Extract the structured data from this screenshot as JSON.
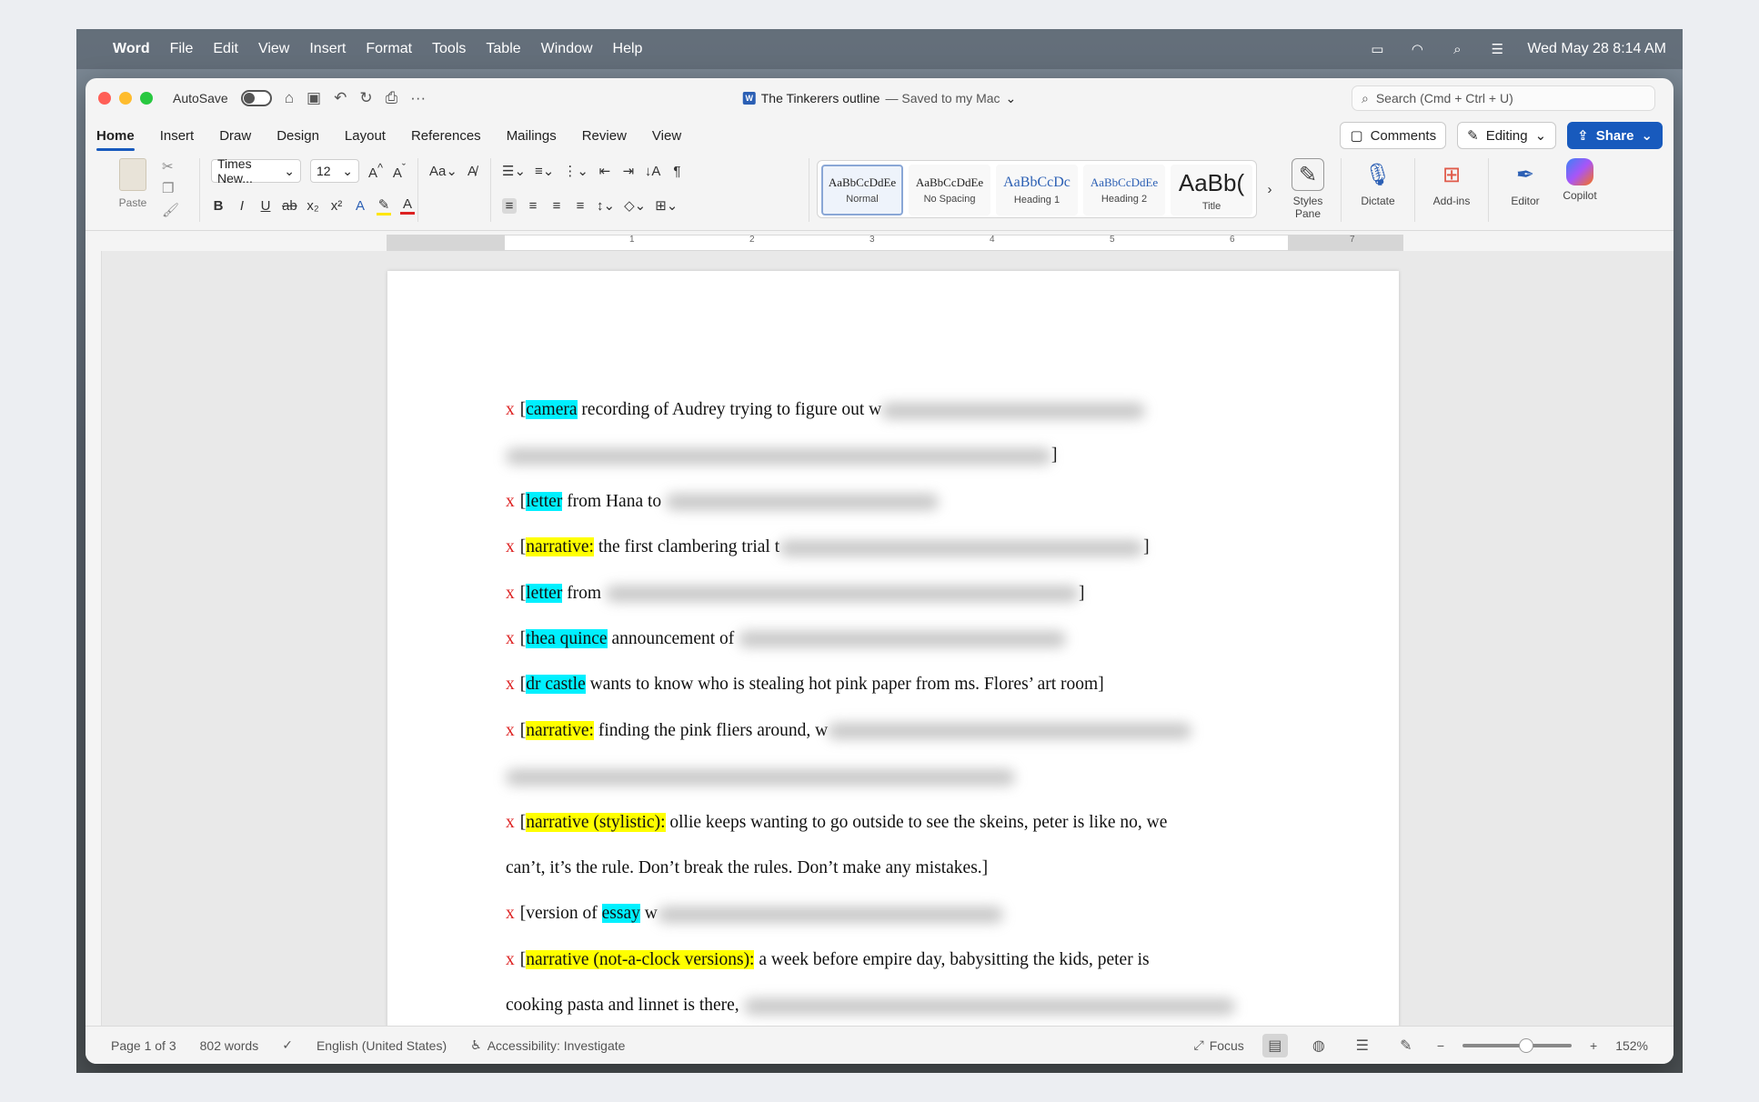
{
  "menubar": {
    "app": "Word",
    "items": [
      "File",
      "Edit",
      "View",
      "Insert",
      "Format",
      "Tools",
      "Table",
      "Window",
      "Help"
    ],
    "datetime": "Wed May 28  8:14 AM"
  },
  "titlebar": {
    "autosave_label": "AutoSave",
    "doc_name": "The Tinkerers outline",
    "saved_status": "— Saved to my Mac",
    "search_placeholder": "Search (Cmd + Ctrl + U)"
  },
  "tabs": [
    "Home",
    "Insert",
    "Draw",
    "Design",
    "Layout",
    "References",
    "Mailings",
    "Review",
    "View"
  ],
  "tab_actions": {
    "comments": "Comments",
    "editing": "Editing",
    "share": "Share"
  },
  "ribbon": {
    "paste": "Paste",
    "font_name": "Times New...",
    "font_size": "12",
    "styles": [
      {
        "preview": "AaBbCcDdEe",
        "name": "Normal"
      },
      {
        "preview": "AaBbCcDdEe",
        "name": "No Spacing"
      },
      {
        "preview": "AaBbCcDc",
        "name": "Heading 1"
      },
      {
        "preview": "AaBbCcDdEe",
        "name": "Heading 2"
      },
      {
        "preview": "AaBb(",
        "name": "Title"
      }
    ],
    "styles_pane": "Styles Pane",
    "dictate": "Dictate",
    "addins": "Add-ins",
    "editor": "Editor",
    "copilot": "Copilot"
  },
  "ruler_numbers": [
    "1",
    "2",
    "3",
    "4",
    "5",
    "6",
    "7"
  ],
  "document": {
    "lines": [
      {
        "x": "x",
        "tag": "camera",
        "color": "cyan",
        "text": " recording of Audrey trying to figure out w",
        "blur": 290
      },
      {
        "x": "",
        "tag": "",
        "color": "",
        "text": "",
        "blur": 600,
        "tail": "]"
      },
      {
        "x": "x",
        "tag": "letter",
        "color": "cyan",
        "text": " from Hana to ",
        "blur": 300
      },
      {
        "x": "x",
        "tag": "narrative:",
        "color": "yellow",
        "text": " the first clambering trial t",
        "blur": 400,
        "tail": "]"
      },
      {
        "x": "x",
        "tag": "letter",
        "color": "cyan",
        "text": " from ",
        "blur": 520,
        "tail": "]"
      },
      {
        "x": "x",
        "tag": "thea quince",
        "color": "cyan",
        "text": " announcement of ",
        "blur": 360
      },
      {
        "x": "x",
        "tag": "dr castle",
        "color": "cyan",
        "text": " wants to know who is stealing hot pink paper from ms. Flores’ art room]",
        "blur": 0
      },
      {
        "x": "x",
        "tag": "narrative:",
        "color": "yellow",
        "text": " finding the pink fliers around, w",
        "blur": 400
      },
      {
        "x": "",
        "tag": "",
        "color": "",
        "text": "",
        "blur": 560
      },
      {
        "x": "x",
        "tag": "narrative (stylistic):",
        "color": "yellow",
        "text": " ollie keeps wanting to go outside to see the skeins, peter is like no, we",
        "blur": 0
      },
      {
        "x": "",
        "tag": "",
        "color": "",
        "text": "can’t, it’s the rule. Don’t break the rules. Don’t make any mistakes.]",
        "blur": 0
      },
      {
        "x": "x",
        "tag": "",
        "color": "",
        "text": "[version of ",
        "blur": 0,
        "tag2": "essay",
        "after": " w",
        "blur2": 380
      },
      {
        "x": "x",
        "tag": "narrative (not-a-clock versions):",
        "color": "yellow",
        "text": " a week before empire day, babysitting the kids, peter is",
        "blur": 0
      },
      {
        "x": "",
        "tag": "",
        "color": "",
        "text": "cooking pasta and linnet is there, ",
        "blur": 540
      }
    ]
  },
  "statusbar": {
    "page": "Page 1 of 3",
    "words": "802 words",
    "language": "English (United States)",
    "accessibility": "Accessibility: Investigate",
    "focus": "Focus",
    "zoom": "152%"
  }
}
